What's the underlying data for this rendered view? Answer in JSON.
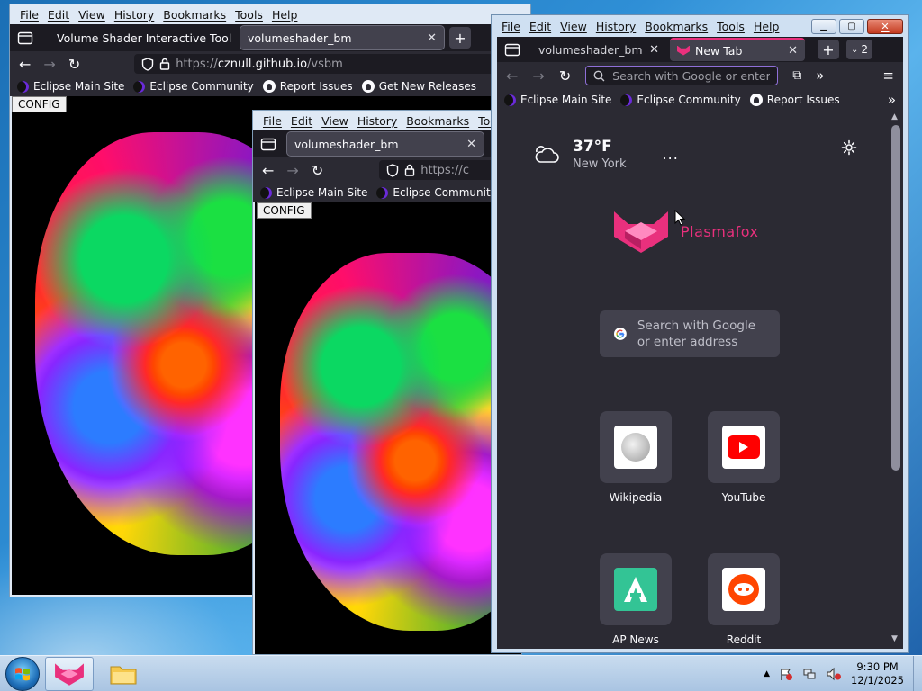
{
  "menu": [
    "File",
    "Edit",
    "View",
    "History",
    "Bookmarks",
    "Tools",
    "Help"
  ],
  "menu_back": [
    "File",
    "Edit",
    "View",
    "History",
    "Bookmarks",
    "Tools"
  ],
  "win1": {
    "tabs": [
      {
        "label": "Volume Shader Interactive Tool"
      },
      {
        "label": "volumeshader_bm"
      }
    ],
    "url_scheme": "https://",
    "url_host": "cznull.github.io",
    "url_path": "/vsbm",
    "bookmarks": [
      "Eclipse Main Site",
      "Eclipse Community",
      "Report Issues",
      "Get New Releases"
    ],
    "config": "CONFIG"
  },
  "win2": {
    "tab": "volumeshader_bm",
    "url_partial": "https://c",
    "bookmarks": [
      "Eclipse Main Site",
      "Eclipse Community"
    ],
    "config": "CONFIG"
  },
  "win3": {
    "tabs": [
      {
        "label": "volumeshader_bm"
      },
      {
        "label": "New Tab"
      }
    ],
    "tab_count": "2",
    "search_placeholder": "Search with Google or enter",
    "bookmarks": [
      "Eclipse Main Site",
      "Eclipse Community",
      "Report Issues"
    ],
    "weather": {
      "temp": "37°F",
      "city": "New York",
      "more": "..."
    },
    "brand": "Plasmafox",
    "search_box": "Search with Google or enter address",
    "shortcuts": [
      {
        "label": "Wikipedia"
      },
      {
        "label": "YouTube"
      },
      {
        "label": "AP News"
      },
      {
        "label": "Reddit"
      }
    ]
  },
  "clock": {
    "time": "9:30 PM",
    "date": "12/1/2025"
  },
  "colors": {
    "accent": "#e9307d",
    "tab_bg": "#42414d",
    "chrome": "#2b2a33",
    "newtab_bg": "#2b2a33"
  }
}
